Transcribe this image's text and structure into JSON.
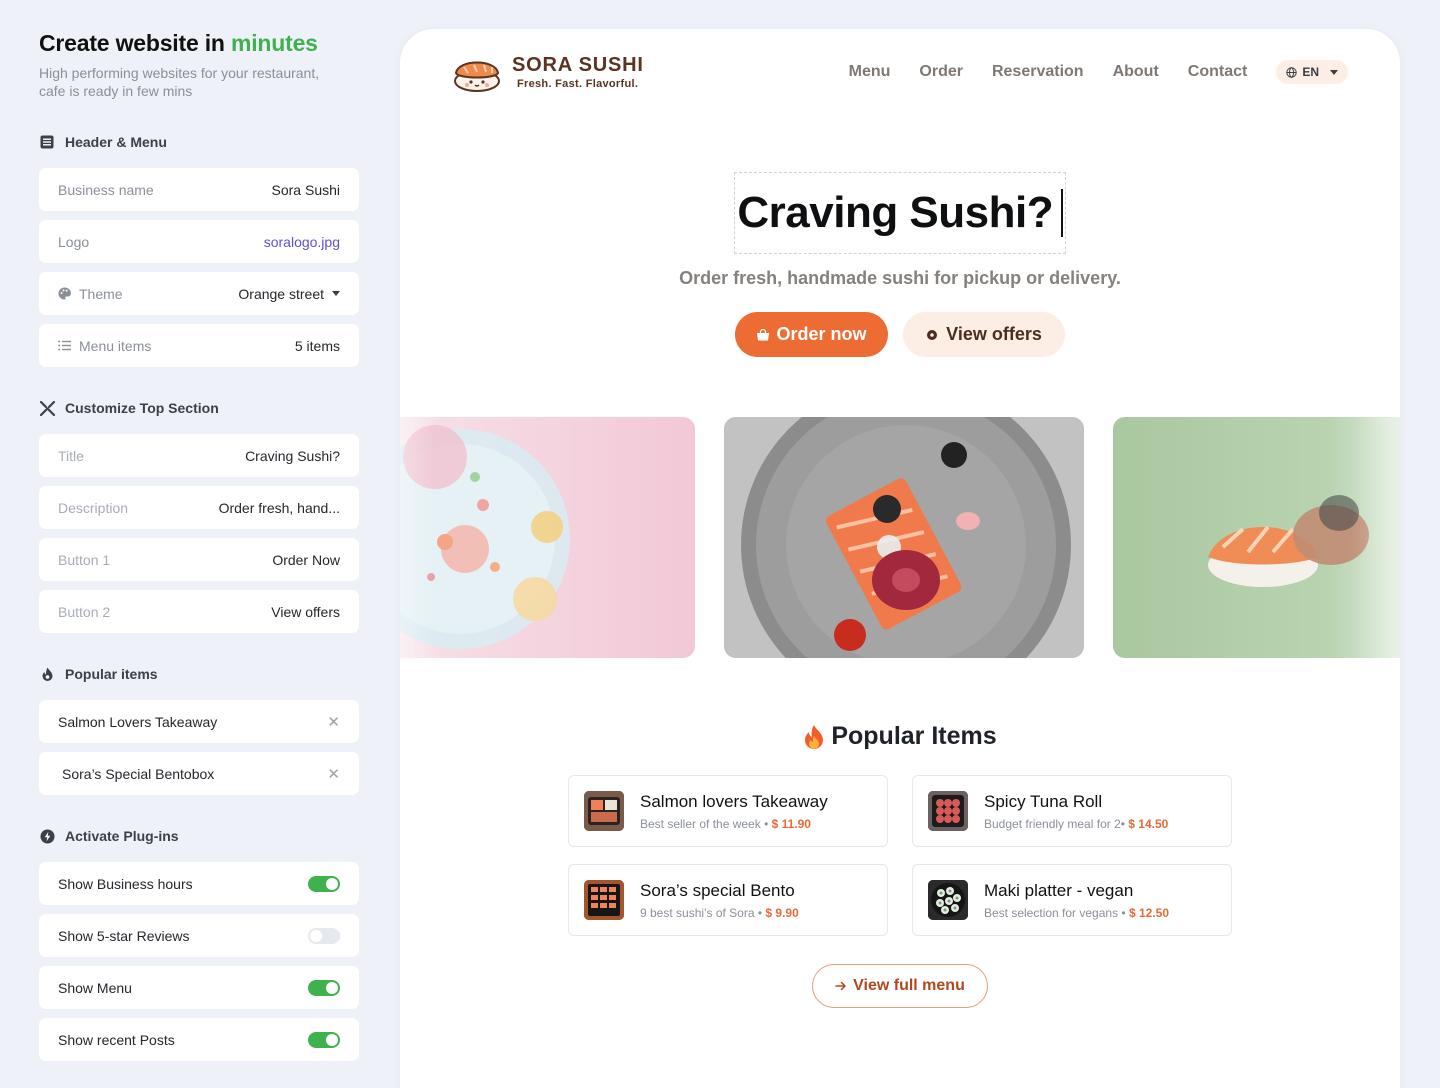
{
  "panel": {
    "title_main": "Create website in",
    "title_accent": "minutes",
    "subtitle": "High performing websites for your restaurant, cafe is ready in few mins",
    "accent_color": "#3fb24f"
  },
  "header_menu": {
    "heading": "Header & Menu",
    "business_name": {
      "label": "Business name",
      "value": "Sora Sushi"
    },
    "logo": {
      "label": "Logo",
      "value": "soralogo.jpg"
    },
    "theme": {
      "label": "Theme",
      "value": "Orange street"
    },
    "menu_items": {
      "label": "Menu items",
      "value": "5 items"
    }
  },
  "top_section": {
    "heading": "Customize Top Section",
    "title": {
      "label": "Title",
      "value": "Craving Sushi?"
    },
    "description": {
      "label": "Description",
      "value": "Order fresh, hand..."
    },
    "button1": {
      "label": "Button 1",
      "value": "Order Now"
    },
    "button2": {
      "label": "Button 2",
      "value": "View offers"
    }
  },
  "popular_settings": {
    "heading": "Popular items",
    "items": [
      "Salmon Lovers Takeaway",
      "Sora’s Special Bentobox"
    ],
    "remove_symbol": "✕"
  },
  "plugins": {
    "heading": "Activate Plug-ins",
    "items": [
      {
        "label": "Show Business hours",
        "enabled": true
      },
      {
        "label": "Show 5-star Reviews",
        "enabled": false
      },
      {
        "label": "Show Menu",
        "enabled": true
      },
      {
        "label": "Show recent Posts",
        "enabled": true
      }
    ]
  },
  "site": {
    "brand_name": "SORA SUSHI",
    "brand_tagline": "Fresh. Fast. Flavorful.",
    "nav": [
      "Menu",
      "Order",
      "Reservation",
      "About",
      "Contact"
    ],
    "language": "EN",
    "hero_title": "Craving Sushi?",
    "hero_description": "Order fresh, handmade sushi for pickup or delivery.",
    "primary_button": "Order now",
    "secondary_button": "View offers",
    "popular_title": "Popular Items",
    "popular_items": [
      {
        "name": "Salmon lovers Takeaway",
        "desc": "Best seller of the week",
        "sep": " • ",
        "price": "$ 11.90"
      },
      {
        "name": "Spicy Tuna Roll",
        "desc": "Budget friendly meal for 2",
        "sep": "• ",
        "price": "$ 14.50"
      },
      {
        "name": "Sora’s special Bento",
        "desc": "9 best sushi’s of Sora",
        "sep": " • ",
        "price": "$ 9.90"
      },
      {
        "name": "Maki platter - vegan",
        "desc": "Best selection for vegans",
        "sep": " • ",
        "price": "$ 12.50"
      }
    ],
    "full_menu_button": "View full menu",
    "accent_color": "#ec6c33"
  }
}
